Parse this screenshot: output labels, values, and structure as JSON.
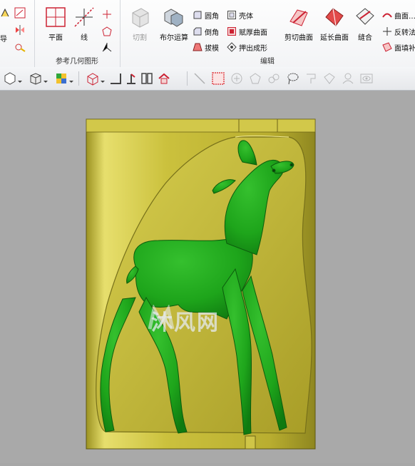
{
  "ribbon": {
    "left_partial": {
      "item1": "导"
    },
    "ref_geometry": {
      "group_label": "参考几何图形",
      "plane_label": "平面",
      "line_label": "线"
    },
    "edit": {
      "group_label": "编辑",
      "cut_label": "切割",
      "boolean_label": "布尔运算",
      "fillet_label": "圆角",
      "chamfer_label": "倒角",
      "draft_label": "拔模",
      "shell_label": "壳体",
      "thicken_label": "赋厚曲面",
      "extrude_label": "押出成形",
      "trim_label": "剪切曲面",
      "extend_label": "延长曲面",
      "stitch_label": "缝合",
      "curve_label": "曲面…",
      "reverse_label": "反转法",
      "fill_label": "面填补"
    }
  },
  "watermark": {
    "text": "沐风网"
  },
  "colors": {
    "model_gold": "#c9bf3a",
    "deer_green": "#1fa51d",
    "viewport_bg": "#a9a9a9",
    "highlight_box": "#e0454a"
  }
}
